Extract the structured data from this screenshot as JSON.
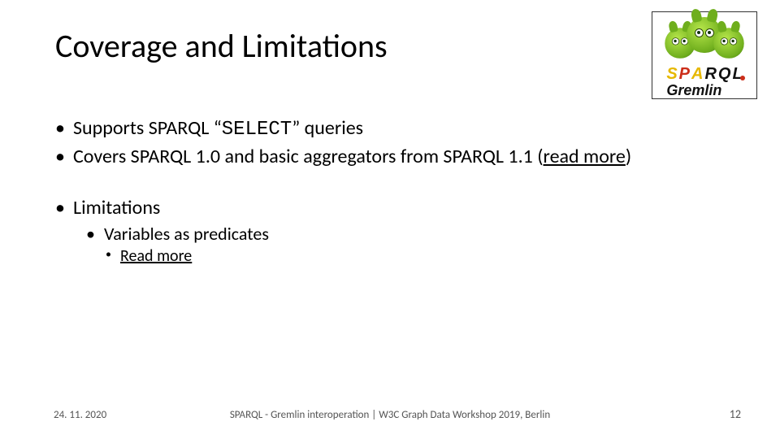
{
  "title": "Coverage and Limitations",
  "logo": {
    "line1_chars": [
      "S",
      "P",
      "A",
      "R",
      "Q",
      "L"
    ],
    "line2": "Gremlin"
  },
  "bullets": {
    "b1a_pre": "Supports SPARQL “",
    "b1a_code": "SELECT",
    "b1a_post": "” queries",
    "b1b_pre": "Covers SPARQL 1.0 and basic aggregators from SPARQL 1.1 (",
    "b1b_link": "read more",
    "b1b_post": ")",
    "b1c": "Limitations",
    "b2a": "Variables as predicates",
    "b3a_link": "Read more"
  },
  "footer": {
    "date": "24. 11. 2020",
    "center": "SPARQL - Gremlin interoperation | W3C Graph Data Workshop 2019, Berlin",
    "page": "12"
  }
}
